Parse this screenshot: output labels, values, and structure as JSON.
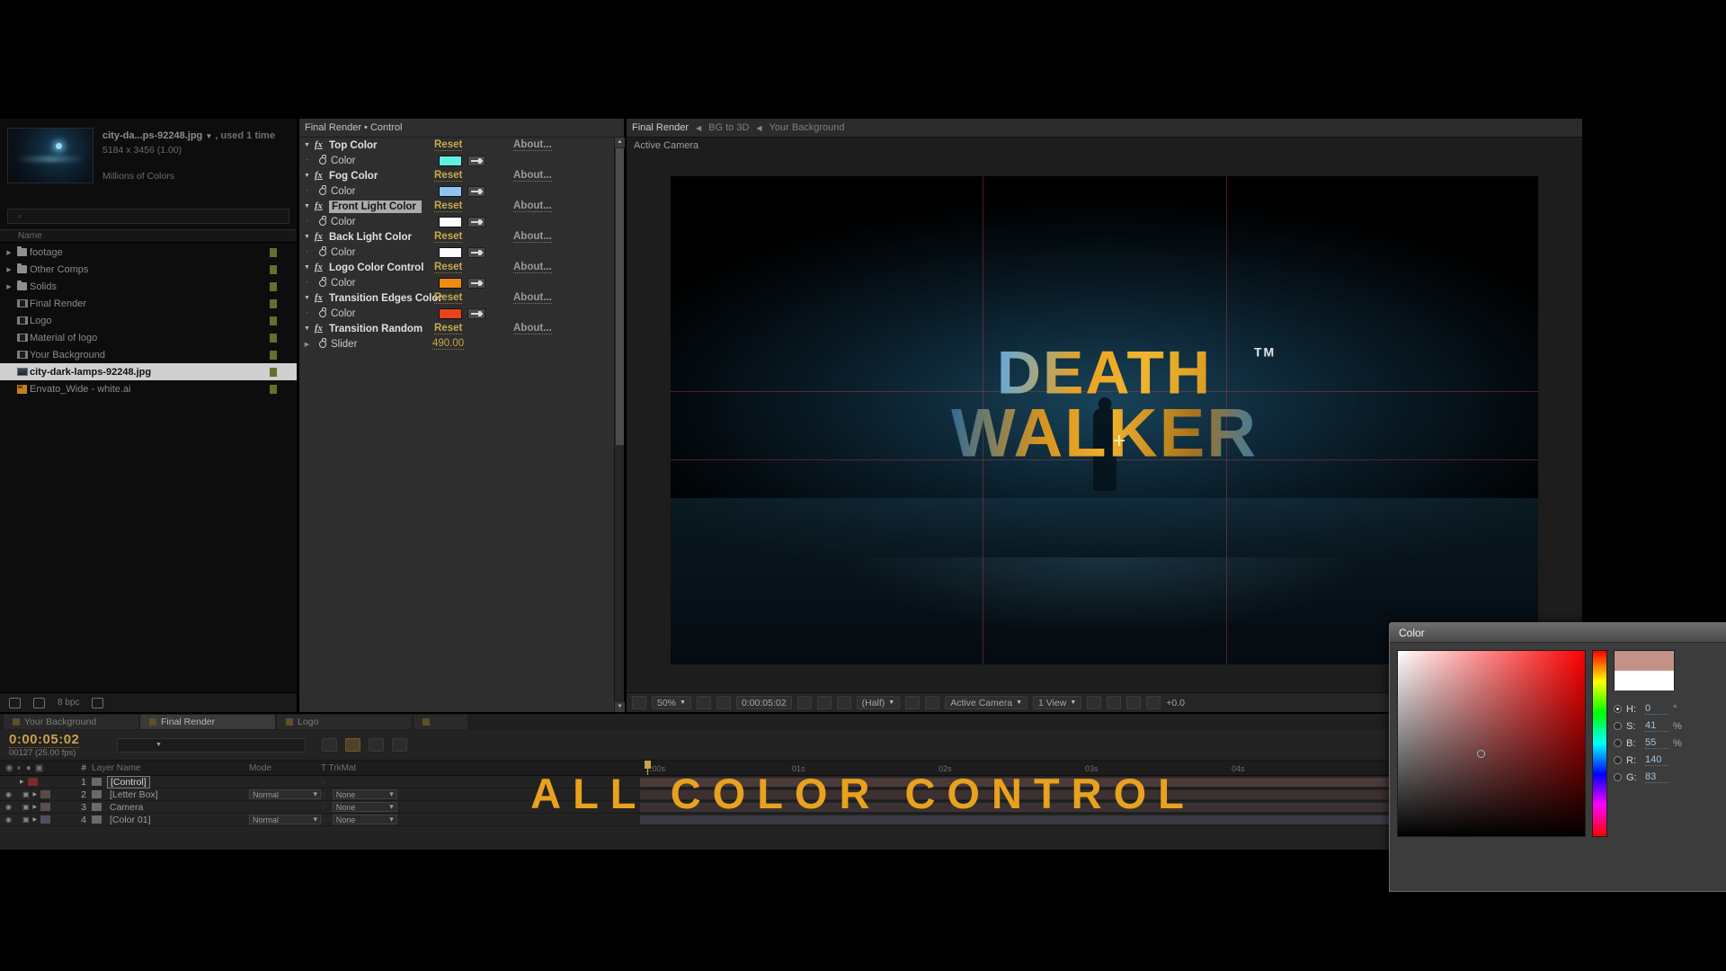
{
  "project_panel": {
    "asset": {
      "name": "city-da...ps-92248.jpg",
      "caret": "▼",
      "usage": ", used 1 time",
      "dimensions": "5184 x 3456 (1.00)",
      "color_depth": "Millions of Colors"
    },
    "search_placeholder": "",
    "column_header": "Name",
    "items": [
      {
        "label": "footage",
        "icon": "folder-icon",
        "twirl": "▶",
        "selected": false,
        "swatch": "#6b6b2e"
      },
      {
        "label": "Other Comps",
        "icon": "folder-icon",
        "twirl": "▶",
        "selected": false,
        "swatch": "#6b6b2e"
      },
      {
        "label": "Solids",
        "icon": "folder-icon",
        "twirl": "▶",
        "selected": false,
        "swatch": "#6b6b2e"
      },
      {
        "label": "Final Render",
        "icon": "comp-icon",
        "twirl": "",
        "selected": false,
        "swatch": "#6b6b2e"
      },
      {
        "label": "Logo",
        "icon": "comp-icon",
        "twirl": "",
        "selected": false,
        "swatch": "#6b6b2e"
      },
      {
        "label": "Material of logo",
        "icon": "comp-icon",
        "twirl": "",
        "selected": false,
        "swatch": "#6b6b2e"
      },
      {
        "label": "Your Background",
        "icon": "comp-icon",
        "twirl": "",
        "selected": false,
        "swatch": "#6b6b2e"
      },
      {
        "label": "city-dark-lamps-92248.jpg",
        "icon": "image-icon",
        "twirl": "",
        "selected": true,
        "swatch": "#6b6b2e"
      },
      {
        "label": "Envato_Wide - white.ai",
        "icon": "illustrator-icon",
        "twirl": "",
        "selected": false,
        "swatch": "#6b6b2e"
      }
    ],
    "footer": {
      "bit_depth": "8 bpc"
    }
  },
  "effects_panel": {
    "tab_title": "Final Render • Control",
    "reset_label": "Reset",
    "about_label": "About...",
    "effects": [
      {
        "name": "Top Color",
        "selected": false,
        "property": "Color",
        "swatch": "#5ff0e3",
        "value": null
      },
      {
        "name": "Fog Color",
        "selected": false,
        "property": "Color",
        "swatch": "#8ec5ef",
        "value": null
      },
      {
        "name": "Front Light Color",
        "selected": true,
        "property": "Color",
        "swatch": "#ffffff",
        "value": null
      },
      {
        "name": "Back Light Color",
        "selected": false,
        "property": "Color",
        "swatch": "#ffffff",
        "value": null
      },
      {
        "name": "Logo Color Control",
        "selected": false,
        "property": "Color",
        "swatch": "#f08a12",
        "value": null
      },
      {
        "name": "Transition Edges Color",
        "selected": false,
        "property": "Color",
        "swatch": "#e8431a",
        "value": null
      },
      {
        "name": "Transition Random",
        "selected": false,
        "property": "Slider",
        "swatch": null,
        "value": "490.00"
      }
    ]
  },
  "viewer_panel": {
    "tabs": [
      {
        "label": "Final Render",
        "active": true
      },
      {
        "label": "BG to 3D",
        "active": false
      },
      {
        "label": "Your Background",
        "active": false
      }
    ],
    "view_label": "Active Camera",
    "composition": {
      "title_line1": "DEATH",
      "title_line2": "WALKER",
      "trademark": "TM"
    },
    "toolbar": {
      "magnification": "50%",
      "current_time": "0:00:05:02",
      "resolution": "(Half)",
      "camera_view": "Active Camera",
      "view_count": "1 View",
      "exposure": "+0.0"
    }
  },
  "timeline_panel": {
    "tabs": [
      {
        "label": "Your Background",
        "active": false
      },
      {
        "label": "Final Render",
        "active": true
      },
      {
        "label": "Logo",
        "active": false
      },
      {
        "label": "",
        "active": false
      }
    ],
    "timecode": "0:00:05:02",
    "frame_info": "00127 (25.00 fps)",
    "columns": {
      "num": "#",
      "layer_name": "Layer Name",
      "mode": "Mode",
      "trkmat": "T TrkMat"
    },
    "layers": [
      {
        "num": "1",
        "name": "[Control]",
        "editing": true,
        "mode": "",
        "trkmat": "",
        "bar_color": "#4a3a3a",
        "swatch": "#7a2a2a",
        "icon": "solid-icon"
      },
      {
        "num": "2",
        "name": "[Letter Box]",
        "editing": false,
        "mode": "Normal",
        "trkmat": "None",
        "bar_color": "#3c3030",
        "swatch": "#5a4a45",
        "icon": "comp-icon"
      },
      {
        "num": "3",
        "name": "Camera",
        "editing": false,
        "mode": "",
        "trkmat": "None",
        "bar_color": "#3a3232",
        "swatch": "#5a5050",
        "icon": "camera-icon"
      },
      {
        "num": "4",
        "name": "[Color 01]",
        "editing": false,
        "mode": "Normal",
        "trkmat": "None",
        "bar_color": "#3a3a44",
        "swatch": "#4e5060",
        "icon": "solid-icon"
      }
    ],
    "ruler_ticks": [
      "1:00s",
      "01s",
      "02s",
      "03s",
      "04s"
    ]
  },
  "overlay": {
    "text": "ALL COLOR CONTROL",
    "color": "#e8a21e"
  },
  "color_picker": {
    "title": "Color",
    "fields": [
      {
        "radio": true,
        "label": "H:",
        "value": "0",
        "unit": "°"
      },
      {
        "radio": false,
        "label": "S:",
        "value": "41",
        "unit": "%"
      },
      {
        "radio": false,
        "label": "B:",
        "value": "55",
        "unit": "%"
      },
      {
        "radio": false,
        "label": "R:",
        "value": "140",
        "unit": ""
      },
      {
        "radio": false,
        "label": "G:",
        "value": "83",
        "unit": ""
      }
    ],
    "new_color": "#c29287",
    "current_color": "#ffffff"
  }
}
